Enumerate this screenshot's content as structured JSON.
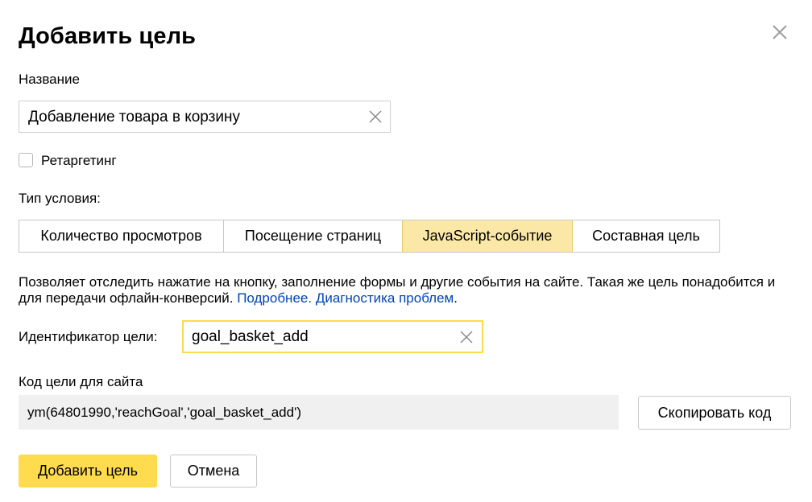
{
  "dialog": {
    "title": "Добавить цель",
    "close_icon": "close-icon"
  },
  "name_field": {
    "label": "Название",
    "value": "Добавление товара в корзину",
    "clear_icon": "clear-icon"
  },
  "retargeting": {
    "label": "Ретаргетинг",
    "checked": false
  },
  "condition_type": {
    "label": "Тип условия:",
    "tabs": [
      {
        "label": "Количество просмотров",
        "active": false
      },
      {
        "label": "Посещение страниц",
        "active": false
      },
      {
        "label": "JavaScript-событие",
        "active": true
      },
      {
        "label": "Составная цель",
        "active": false
      }
    ]
  },
  "description": {
    "text": "Позволяет отследить нажатие на кнопку, заполнение формы и другие события на сайте. Такая же цель понадобится и для передачи офлайн-конверсий. ",
    "link_more": "Подробнее.",
    "link_diagnostics": "Диагностика проблем",
    "trailing": "."
  },
  "goal_id": {
    "label": "Идентификатор цели:",
    "value": "goal_basket_add",
    "clear_icon": "clear-icon"
  },
  "goal_code": {
    "label": "Код цели для сайта",
    "code": "ym(64801990,'reachGoal','goal_basket_add')",
    "copy_button": "Скопировать код"
  },
  "footer": {
    "submit_label": "Добавить цель",
    "cancel_label": "Отмена"
  },
  "colors": {
    "accent": "#ffdb4d",
    "active_tab": "#fce8a6",
    "link": "#0044bb",
    "code_bg": "#f0f0f0"
  }
}
